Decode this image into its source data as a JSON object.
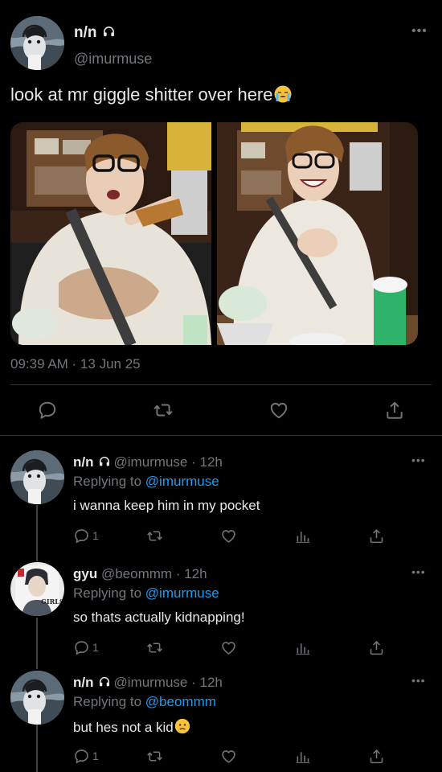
{
  "main_tweet": {
    "author_name": "n/n",
    "author_handle": "@imurmuse",
    "text": "look at mr giggle shitter over here",
    "emoji": "loudly-crying-face",
    "timestamp": "09:39 AM · 13 Jun 25",
    "more_label": "•••"
  },
  "replies": [
    {
      "name": "n/n",
      "handle": "@imurmuse",
      "time": "· 12h",
      "replying_prefix": "Replying to",
      "replying_to": "@imurmuse",
      "text": "i wanna keep him in my pocket",
      "emoji": "",
      "reply_count": "1"
    },
    {
      "name": "gyu",
      "handle": "@beommm",
      "time": "· 12h",
      "replying_prefix": "Replying to",
      "replying_to": "@imurmuse",
      "text": "so thats actually kidnapping!",
      "emoji": "",
      "reply_count": "1",
      "avatar_text": "GIRLS MY"
    },
    {
      "name": "n/n",
      "handle": "@imurmuse",
      "time": "· 12h",
      "replying_prefix": "Replying to",
      "replying_to": "@beommm",
      "text": "but hes not a kid",
      "emoji": "slightly-frowning-face",
      "reply_count": "1"
    }
  ],
  "colors": {
    "background": "#000000",
    "text": "#e7e9ea",
    "secondary": "#71767b",
    "link": "#1d9bf0",
    "divider": "#2f3336"
  }
}
